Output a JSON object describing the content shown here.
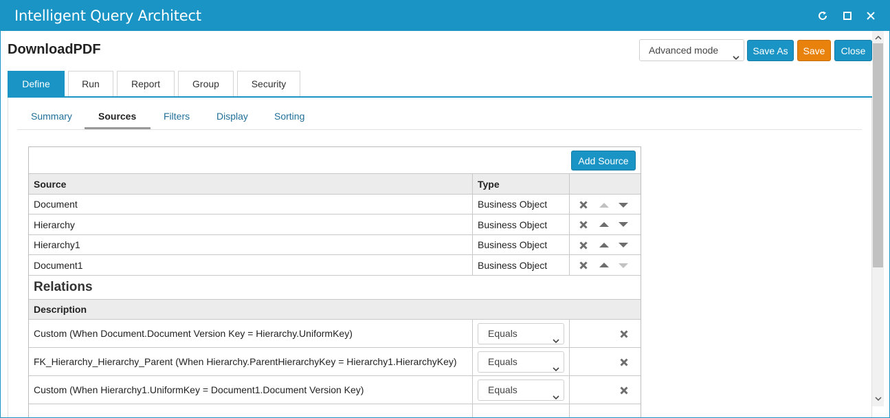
{
  "window": {
    "title": "Intelligent Query Architect",
    "controls": [
      "refresh-icon",
      "maximize-icon",
      "close-icon"
    ]
  },
  "header": {
    "page_title": "DownloadPDF",
    "mode_select": {
      "value": "Advanced mode"
    },
    "buttons": {
      "save_as": "Save As",
      "save": "Save",
      "close": "Close"
    }
  },
  "main_tabs": [
    {
      "label": "Define",
      "active": true
    },
    {
      "label": "Run"
    },
    {
      "label": "Report"
    },
    {
      "label": "Group"
    },
    {
      "label": "Security"
    }
  ],
  "sub_tabs": [
    {
      "label": "Summary"
    },
    {
      "label": "Sources",
      "active": true
    },
    {
      "label": "Filters"
    },
    {
      "label": "Display"
    },
    {
      "label": "Sorting"
    }
  ],
  "sources": {
    "add_button": "Add Source",
    "columns": {
      "source": "Source",
      "type": "Type"
    },
    "rows": [
      {
        "source": "Document",
        "type": "Business Object",
        "up_enabled": false,
        "down_enabled": true
      },
      {
        "source": "Hierarchy",
        "type": "Business Object",
        "up_enabled": true,
        "down_enabled": true
      },
      {
        "source": "Hierarchy1",
        "type": "Business Object",
        "up_enabled": true,
        "down_enabled": true
      },
      {
        "source": "Document1",
        "type": "Business Object",
        "up_enabled": true,
        "down_enabled": false
      }
    ]
  },
  "relations": {
    "title": "Relations",
    "column": "Description",
    "rows": [
      {
        "description": "Custom (When Document.Document Version Key = Hierarchy.UniformKey)",
        "operator": "Equals"
      },
      {
        "description": "FK_Hierarchy_Hierarchy_Parent (When Hierarchy.ParentHierarchyKey = Hierarchy1.HierarchyKey)",
        "operator": "Equals"
      },
      {
        "description": "Custom (When Hierarchy1.UniformKey = Document1.Document Version Key)",
        "operator": "Equals"
      }
    ]
  },
  "colors": {
    "accent": "#1a94c4",
    "save": "#e8820c",
    "header_bg": "#ececec",
    "icon_gray": "#6d6d6d",
    "icon_disabled": "#c2c2c2"
  }
}
